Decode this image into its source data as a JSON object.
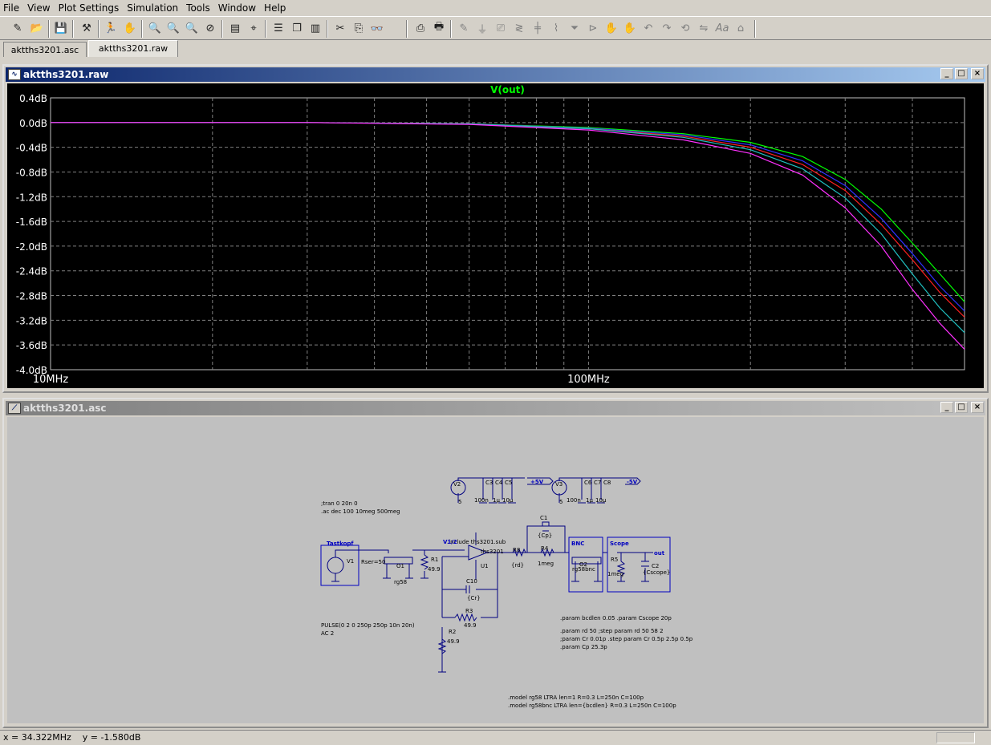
{
  "menu": [
    "File",
    "View",
    "Plot Settings",
    "Simulation",
    "Tools",
    "Window",
    "Help"
  ],
  "toolbar_icons": [
    "new-schematic-icon",
    "open-icon",
    "save-icon",
    "control-panel-icon",
    "run-icon",
    "halt-icon",
    "zoom-in-icon",
    "zoom-box-icon",
    "zoom-out-icon",
    "zoom-cancel-icon",
    "autorange-icon",
    "probe-icon",
    "tile-horizontal-icon",
    "cascade-icon",
    "tile-vertical-icon",
    "cut-icon",
    "copy-icon",
    "find-icon",
    "print-setup-icon",
    "print-icon",
    "wire-icon",
    "ground-icon",
    "label-icon",
    "resistor-icon",
    "capacitor-icon",
    "inductor-icon",
    "diode-icon",
    "component-icon",
    "move-icon",
    "drag-icon",
    "undo-icon",
    "redo-icon",
    "rotate-icon",
    "mirror-icon",
    "text-icon",
    "spice-directive-icon"
  ],
  "tabs": [
    "aktths3201.asc",
    "aktths3201.raw"
  ],
  "plot_window": {
    "title": "aktths3201.raw"
  },
  "schematic_window": {
    "title": "aktths3201.asc"
  },
  "status": {
    "coords": "x = 34.322MHz    y = -1.580dB"
  },
  "colors": {
    "background": "#000000",
    "grid": "#808080",
    "text": "#ffffff",
    "trace_label": "#00ff00",
    "green": "#00ff00",
    "blue": "#3030ff",
    "red": "#ff2020",
    "cyan": "#20c0c0",
    "magenta": "#ff30ff",
    "wire": "#000080",
    "component": "#0000c0"
  },
  "chart_data": {
    "type": "line",
    "title": "V(out)",
    "xlabel": "",
    "ylabel": "",
    "xscale": "log",
    "xlim": [
      10,
      500
    ],
    "xunit": "MHz",
    "ylim": [
      -4.0,
      0.4
    ],
    "y_ticks": [
      "0.4dB",
      "0.0dB",
      "-0.4dB",
      "-0.8dB",
      "-1.2dB",
      "-1.6dB",
      "-2.0dB",
      "-2.4dB",
      "-2.8dB",
      "-3.2dB",
      "-3.6dB",
      "-4.0dB"
    ],
    "x_ticks": [
      "10MHz",
      "100MHz"
    ],
    "grid": true,
    "series": [
      {
        "color": "green",
        "x": [
          10,
          30,
          60,
          100,
          150,
          200,
          250,
          300,
          350,
          400,
          450,
          500
        ],
        "y": [
          0,
          0,
          -0.02,
          -0.08,
          -0.18,
          -0.32,
          -0.55,
          -0.92,
          -1.4,
          -1.95,
          -2.45,
          -2.9
        ]
      },
      {
        "color": "blue",
        "x": [
          10,
          30,
          60,
          100,
          150,
          200,
          250,
          300,
          350,
          400,
          450,
          500
        ],
        "y": [
          0,
          0,
          -0.02,
          -0.09,
          -0.2,
          -0.36,
          -0.62,
          -1.02,
          -1.55,
          -2.12,
          -2.65,
          -3.05
        ]
      },
      {
        "color": "red",
        "x": [
          10,
          30,
          60,
          100,
          150,
          200,
          250,
          300,
          350,
          400,
          450,
          500
        ],
        "y": [
          0,
          0,
          -0.02,
          -0.1,
          -0.22,
          -0.4,
          -0.68,
          -1.1,
          -1.65,
          -2.22,
          -2.75,
          -3.15
        ]
      },
      {
        "color": "cyan",
        "x": [
          10,
          30,
          60,
          100,
          150,
          200,
          250,
          300,
          350,
          400,
          450,
          500
        ],
        "y": [
          0,
          0,
          -0.02,
          -0.1,
          -0.24,
          -0.44,
          -0.75,
          -1.22,
          -1.8,
          -2.45,
          -3.0,
          -3.4
        ]
      },
      {
        "color": "magenta",
        "x": [
          10,
          30,
          60,
          100,
          150,
          200,
          250,
          300,
          350,
          400,
          450,
          500
        ],
        "y": [
          0,
          0,
          -0.03,
          -0.12,
          -0.28,
          -0.5,
          -0.85,
          -1.38,
          -2.0,
          -2.7,
          -3.25,
          -3.67
        ]
      }
    ]
  },
  "schematic": {
    "directives": {
      "tran": ";tran 0 20n 0",
      "ac": ".ac dec 100 10meg 500meg",
      "include": ".include ths3201.sub",
      "params1": ".param bcdlen 0.05   .param Cscope 20p",
      "params2": ".param rd 50        ;step param rd 50 58 2",
      "params3": ";param Cr 0.01p  .step param Cr 0.5p 2.5p 0.5p",
      "params4": ".param Cp 25.3p",
      "model1": ".model rg58 LTRA len=1 R=0.3 L=250n C=100p",
      "model2": ".model rg58bnc LTRA len={bcdlen} R=0.3 L=250n C=100p"
    },
    "labels": {
      "tastkopf": "Tastkopf",
      "v1": "V1",
      "rser": "Rser=50",
      "pulse": "PULSE(0 2 0 250p 250p 10n 20n)",
      "ac2": "AC 2",
      "o1": "O1",
      "rg58": "rg58",
      "r1": "R1",
      "r1v": "49.9",
      "v12": "V1/2",
      "ths": "ths3201",
      "u1": "U1",
      "r8": "R8",
      "r8v": "{rd}",
      "r4": "R4",
      "r4v": "1meg",
      "c1": "C1",
      "c1v": "{Cp}",
      "c10": "C10",
      "c10v": "{Cr}",
      "r3": "R3",
      "r3v": "49.9",
      "r2": "R2",
      "r2v": "49.9",
      "bnc": "BNC",
      "o2": "O2",
      "rg58bnc": "rg58bnc",
      "scope": "Scope",
      "r5": "R5",
      "r5v": "1meg",
      "c2": "C2",
      "c2v": "{Cscope}",
      "out": "out",
      "v2": "V2",
      "v2v": "5",
      "v3": "V3",
      "v3v": "5",
      "p5v": "+5V",
      "m5v": "-5V",
      "c3": "C3",
      "c4": "C4",
      "c5": "C5",
      "c6": "C6",
      "c7": "C7",
      "c8": "C8",
      "c100n": "100n",
      "c1u": "1µ",
      "c10u": "10µ"
    }
  }
}
